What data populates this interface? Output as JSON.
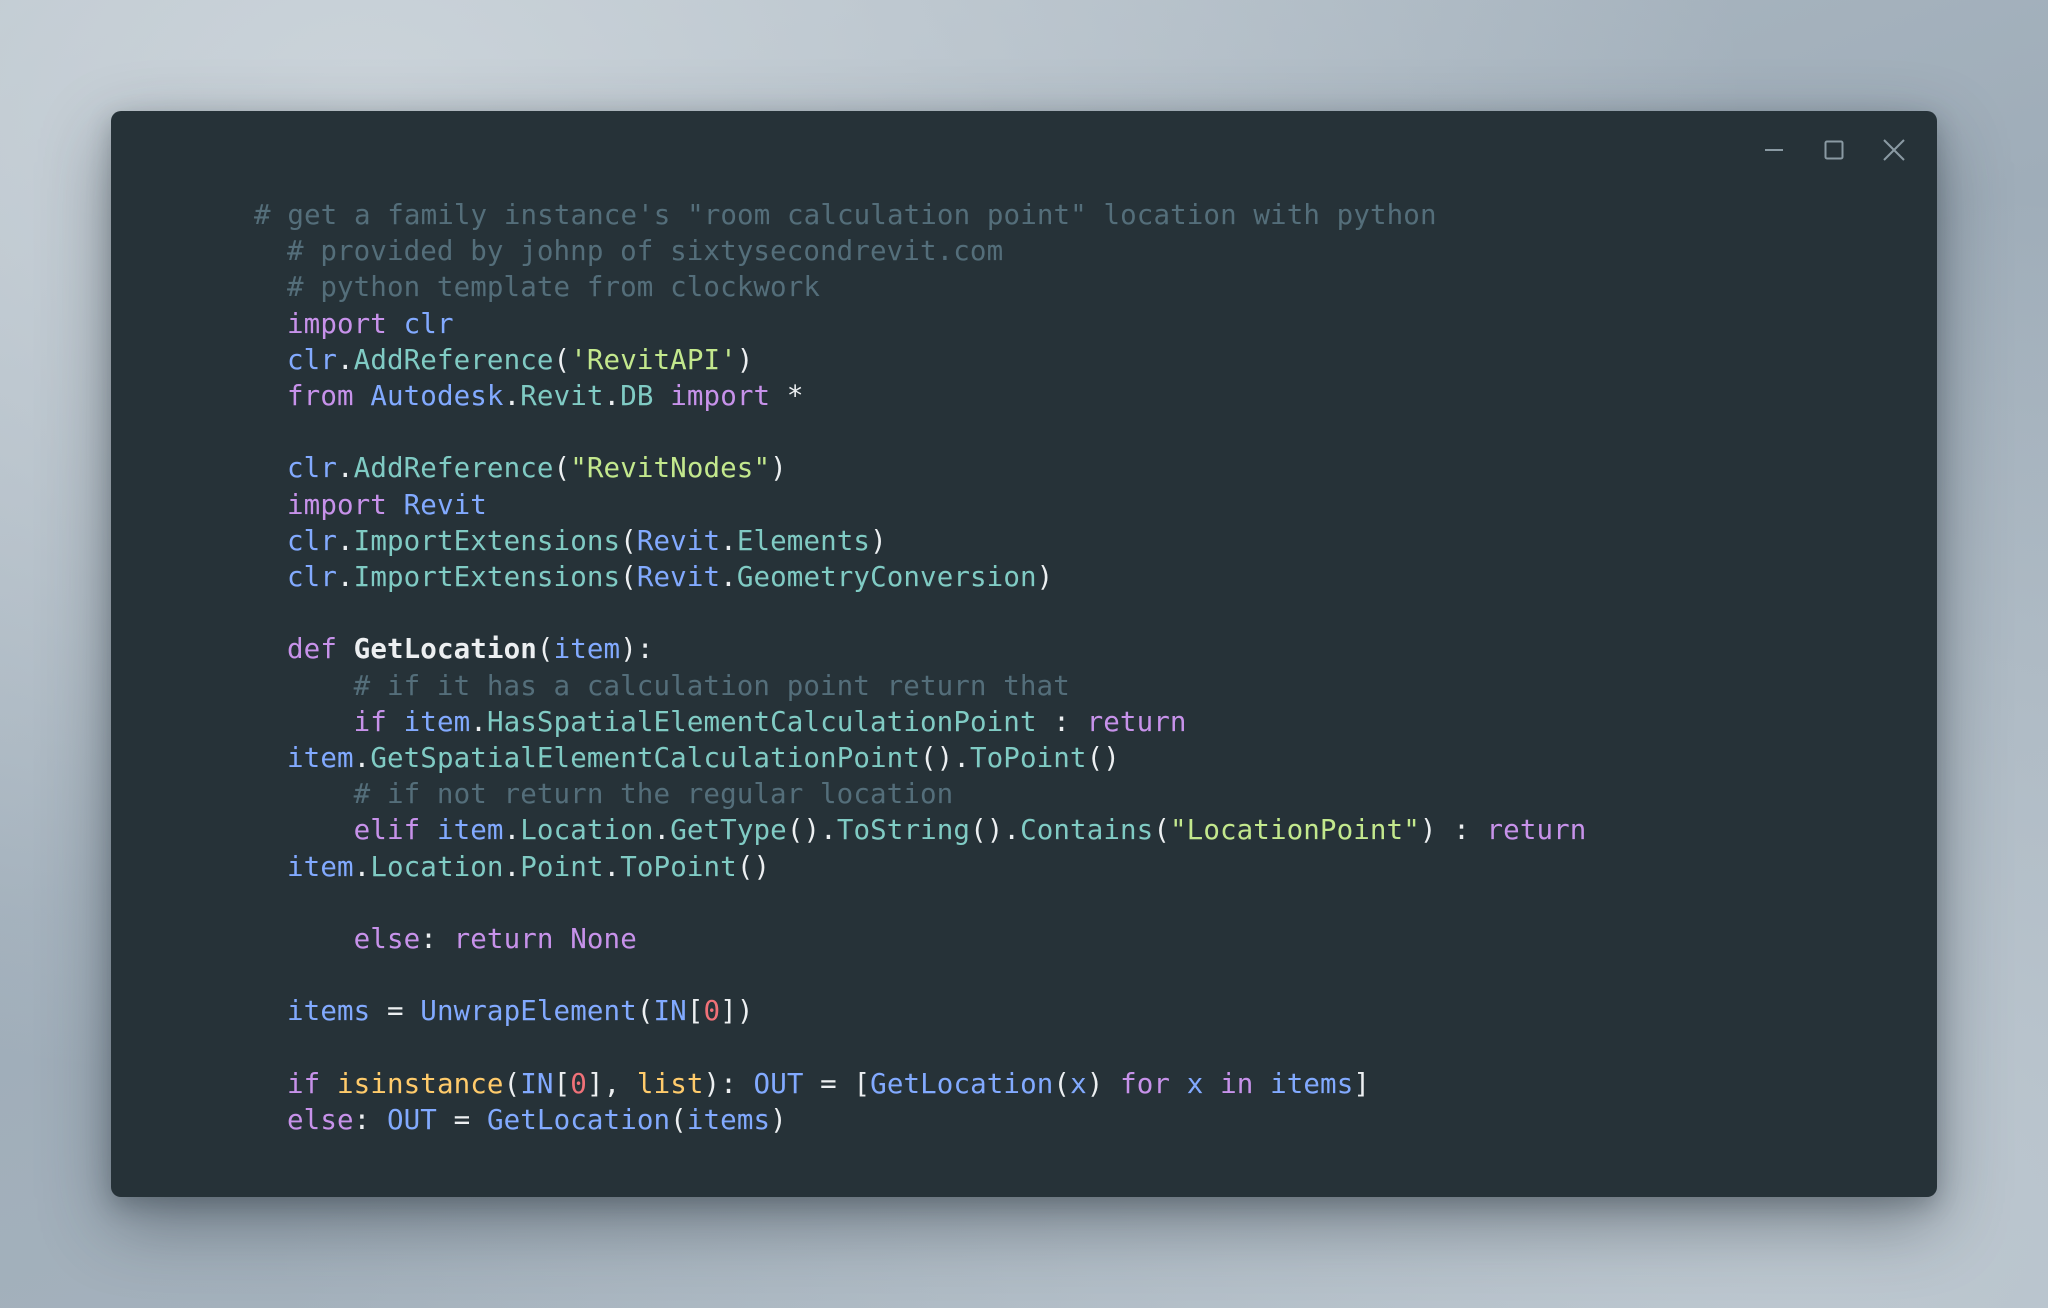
{
  "window": {
    "title": "",
    "background_color": "#263238",
    "controls": [
      {
        "name": "minimize",
        "glyph": "minimize-icon",
        "label": "Minimize"
      },
      {
        "name": "maximize",
        "glyph": "maximize-icon",
        "label": "Maximize"
      },
      {
        "name": "close",
        "glyph": "close-icon",
        "label": "Close"
      }
    ]
  },
  "theme": {
    "comment": "#546e7a",
    "keyword": "#c792ea",
    "identifier": "#82aaff",
    "method": "#80cbc4",
    "string": "#c3e88d",
    "builtin": "#ffcb6b",
    "number": "#f07178",
    "punctuation": "#eceff1",
    "background": "#263238",
    "page_background": "#a8b4be"
  },
  "code": {
    "language": "python",
    "lines": [
      {
        "n": 1,
        "tokens": [
          {
            "t": "# get a family instance's \"room calculation point\" location with python",
            "c": "c"
          }
        ]
      },
      {
        "n": 2,
        "tokens": [
          {
            "t": "# provided by johnp of sixtysecondrevit.com",
            "c": "c"
          }
        ]
      },
      {
        "n": 3,
        "tokens": [
          {
            "t": "# python template from clockwork",
            "c": "c"
          }
        ]
      },
      {
        "n": 4,
        "tokens": [
          {
            "t": "import",
            "c": "kw"
          },
          {
            "t": " ",
            "c": "pu"
          },
          {
            "t": "clr",
            "c": "id"
          }
        ]
      },
      {
        "n": 5,
        "tokens": [
          {
            "t": "clr",
            "c": "id"
          },
          {
            "t": ".",
            "c": "pu"
          },
          {
            "t": "AddReference",
            "c": "fn"
          },
          {
            "t": "(",
            "c": "pu"
          },
          {
            "t": "'RevitAPI'",
            "c": "st"
          },
          {
            "t": ")",
            "c": "pu"
          }
        ]
      },
      {
        "n": 6,
        "tokens": [
          {
            "t": "from",
            "c": "kw"
          },
          {
            "t": " ",
            "c": "pu"
          },
          {
            "t": "Autodesk",
            "c": "id"
          },
          {
            "t": ".",
            "c": "pu"
          },
          {
            "t": "Revit",
            "c": "fn"
          },
          {
            "t": ".",
            "c": "pu"
          },
          {
            "t": "DB",
            "c": "fn"
          },
          {
            "t": " ",
            "c": "pu"
          },
          {
            "t": "import",
            "c": "kw"
          },
          {
            "t": " ",
            "c": "pu"
          },
          {
            "t": "*",
            "c": "pu"
          }
        ]
      },
      {
        "n": 7,
        "tokens": []
      },
      {
        "n": 8,
        "tokens": [
          {
            "t": "clr",
            "c": "id"
          },
          {
            "t": ".",
            "c": "pu"
          },
          {
            "t": "AddReference",
            "c": "fn"
          },
          {
            "t": "(",
            "c": "pu"
          },
          {
            "t": "\"RevitNodes\"",
            "c": "st"
          },
          {
            "t": ")",
            "c": "pu"
          }
        ]
      },
      {
        "n": 9,
        "tokens": [
          {
            "t": "import",
            "c": "kw"
          },
          {
            "t": " ",
            "c": "pu"
          },
          {
            "t": "Revit",
            "c": "id"
          }
        ]
      },
      {
        "n": 10,
        "tokens": [
          {
            "t": "clr",
            "c": "id"
          },
          {
            "t": ".",
            "c": "pu"
          },
          {
            "t": "ImportExtensions",
            "c": "fn"
          },
          {
            "t": "(",
            "c": "pu"
          },
          {
            "t": "Revit",
            "c": "id"
          },
          {
            "t": ".",
            "c": "pu"
          },
          {
            "t": "Elements",
            "c": "fn"
          },
          {
            "t": ")",
            "c": "pu"
          }
        ]
      },
      {
        "n": 11,
        "tokens": [
          {
            "t": "clr",
            "c": "id"
          },
          {
            "t": ".",
            "c": "pu"
          },
          {
            "t": "ImportExtensions",
            "c": "fn"
          },
          {
            "t": "(",
            "c": "pu"
          },
          {
            "t": "Revit",
            "c": "id"
          },
          {
            "t": ".",
            "c": "pu"
          },
          {
            "t": "GeometryConversion",
            "c": "fn"
          },
          {
            "t": ")",
            "c": "pu"
          }
        ]
      },
      {
        "n": 12,
        "tokens": []
      },
      {
        "n": 13,
        "tokens": [
          {
            "t": "def",
            "c": "kw"
          },
          {
            "t": " ",
            "c": "pu"
          },
          {
            "t": "GetLocation",
            "c": "df"
          },
          {
            "t": "(",
            "c": "pu"
          },
          {
            "t": "item",
            "c": "id"
          },
          {
            "t": "):",
            "c": "pu"
          }
        ]
      },
      {
        "n": 14,
        "tokens": [
          {
            "t": "    # if it has a calculation point return that",
            "c": "c"
          }
        ]
      },
      {
        "n": 15,
        "tokens": [
          {
            "t": "    ",
            "c": "pu"
          },
          {
            "t": "if",
            "c": "kw"
          },
          {
            "t": " ",
            "c": "pu"
          },
          {
            "t": "item",
            "c": "id"
          },
          {
            "t": ".",
            "c": "pu"
          },
          {
            "t": "HasSpatialElementCalculationPoint",
            "c": "fn"
          },
          {
            "t": " : ",
            "c": "pu"
          },
          {
            "t": "return",
            "c": "kw"
          },
          {
            "t": " ",
            "c": "pu"
          },
          {
            "t": "item",
            "c": "id"
          },
          {
            "t": ".",
            "c": "pu"
          },
          {
            "t": "GetSpatialElementCalculationPoint",
            "c": "fn"
          },
          {
            "t": "()",
            "c": "pu"
          },
          {
            "t": ".",
            "c": "pu"
          },
          {
            "t": "ToPoint",
            "c": "fn"
          },
          {
            "t": "()",
            "c": "pu"
          }
        ]
      },
      {
        "n": 16,
        "tokens": [
          {
            "t": "    # if not return the regular location",
            "c": "c"
          }
        ]
      },
      {
        "n": 17,
        "tokens": [
          {
            "t": "    ",
            "c": "pu"
          },
          {
            "t": "elif",
            "c": "kw"
          },
          {
            "t": " ",
            "c": "pu"
          },
          {
            "t": "item",
            "c": "id"
          },
          {
            "t": ".",
            "c": "pu"
          },
          {
            "t": "Location",
            "c": "fn"
          },
          {
            "t": ".",
            "c": "pu"
          },
          {
            "t": "GetType",
            "c": "fn"
          },
          {
            "t": "()",
            "c": "pu"
          },
          {
            "t": ".",
            "c": "pu"
          },
          {
            "t": "ToString",
            "c": "fn"
          },
          {
            "t": "()",
            "c": "pu"
          },
          {
            "t": ".",
            "c": "pu"
          },
          {
            "t": "Contains",
            "c": "fn"
          },
          {
            "t": "(",
            "c": "pu"
          },
          {
            "t": "\"LocationPoint\"",
            "c": "st"
          },
          {
            "t": ") : ",
            "c": "pu"
          },
          {
            "t": "return",
            "c": "kw"
          },
          {
            "t": " ",
            "c": "pu"
          },
          {
            "t": "item",
            "c": "id"
          },
          {
            "t": ".",
            "c": "pu"
          },
          {
            "t": "Location",
            "c": "fn"
          },
          {
            "t": ".",
            "c": "pu"
          },
          {
            "t": "Point",
            "c": "fn"
          },
          {
            "t": ".",
            "c": "pu"
          },
          {
            "t": "ToPoint",
            "c": "fn"
          },
          {
            "t": "()",
            "c": "pu"
          }
        ]
      },
      {
        "n": 18,
        "tokens": []
      },
      {
        "n": 19,
        "tokens": [
          {
            "t": "    ",
            "c": "pu"
          },
          {
            "t": "else",
            "c": "kw"
          },
          {
            "t": ": ",
            "c": "pu"
          },
          {
            "t": "return",
            "c": "kw"
          },
          {
            "t": " ",
            "c": "pu"
          },
          {
            "t": "None",
            "c": "kw"
          }
        ]
      },
      {
        "n": 20,
        "tokens": []
      },
      {
        "n": 21,
        "tokens": [
          {
            "t": "items",
            "c": "id"
          },
          {
            "t": " = ",
            "c": "pu"
          },
          {
            "t": "UnwrapElement",
            "c": "id"
          },
          {
            "t": "(",
            "c": "pu"
          },
          {
            "t": "IN",
            "c": "id"
          },
          {
            "t": "[",
            "c": "pu"
          },
          {
            "t": "0",
            "c": "nu"
          },
          {
            "t": "])",
            "c": "pu"
          }
        ]
      },
      {
        "n": 22,
        "tokens": []
      },
      {
        "n": 23,
        "tokens": [
          {
            "t": "if",
            "c": "kw"
          },
          {
            "t": " ",
            "c": "pu"
          },
          {
            "t": "isinstance",
            "c": "bi"
          },
          {
            "t": "(",
            "c": "pu"
          },
          {
            "t": "IN",
            "c": "id"
          },
          {
            "t": "[",
            "c": "pu"
          },
          {
            "t": "0",
            "c": "nu"
          },
          {
            "t": "], ",
            "c": "pu"
          },
          {
            "t": "list",
            "c": "bi"
          },
          {
            "t": "): ",
            "c": "pu"
          },
          {
            "t": "OUT",
            "c": "id"
          },
          {
            "t": " = ",
            "c": "pu"
          },
          {
            "t": "[",
            "c": "pu"
          },
          {
            "t": "GetLocation",
            "c": "id"
          },
          {
            "t": "(",
            "c": "pu"
          },
          {
            "t": "x",
            "c": "id"
          },
          {
            "t": ") ",
            "c": "pu"
          },
          {
            "t": "for",
            "c": "kw"
          },
          {
            "t": " ",
            "c": "pu"
          },
          {
            "t": "x",
            "c": "id"
          },
          {
            "t": " ",
            "c": "pu"
          },
          {
            "t": "in",
            "c": "kw"
          },
          {
            "t": " ",
            "c": "pu"
          },
          {
            "t": "items",
            "c": "id"
          },
          {
            "t": "]",
            "c": "pu"
          }
        ]
      },
      {
        "n": 24,
        "tokens": [
          {
            "t": "else",
            "c": "kw"
          },
          {
            "t": ": ",
            "c": "pu"
          },
          {
            "t": "OUT",
            "c": "id"
          },
          {
            "t": " = ",
            "c": "pu"
          },
          {
            "t": "GetLocation",
            "c": "id"
          },
          {
            "t": "(",
            "c": "pu"
          },
          {
            "t": "items",
            "c": "id"
          },
          {
            "t": ")",
            "c": "pu"
          }
        ]
      }
    ]
  }
}
